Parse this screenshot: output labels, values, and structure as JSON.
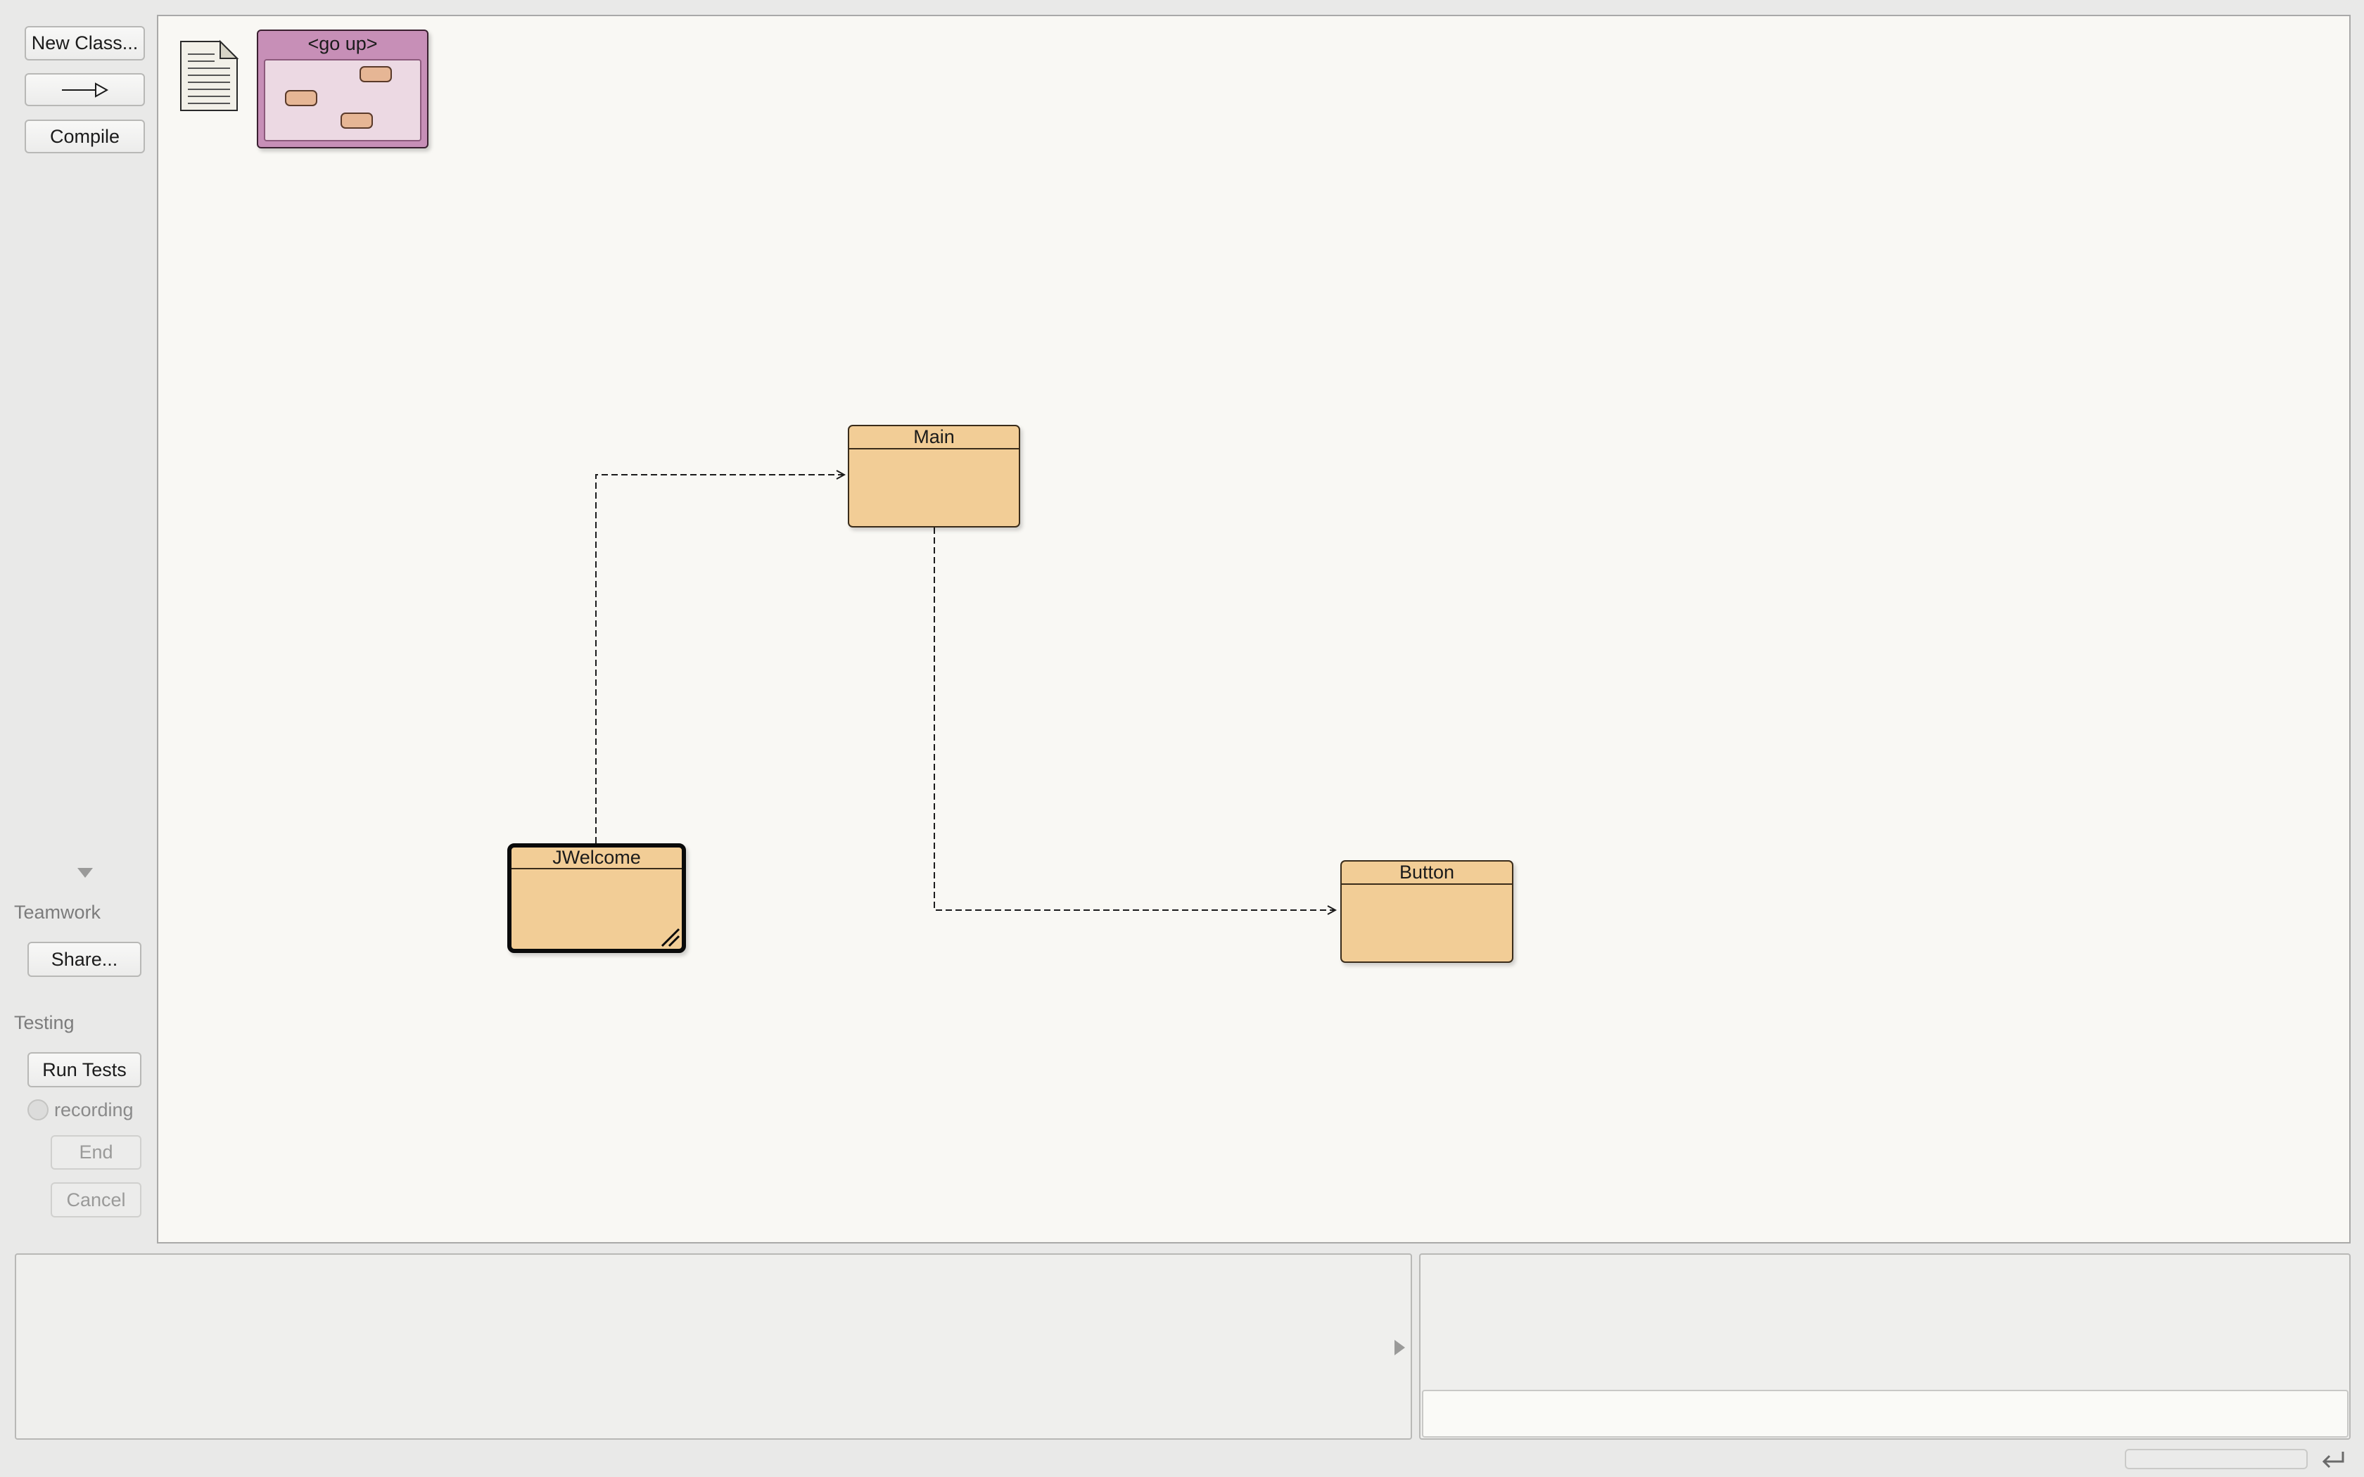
{
  "toolbar": {
    "new_class_label": "New Class...",
    "new_arrow_icon": "inheritance-arrow-icon",
    "compile_label": "Compile"
  },
  "teamwork": {
    "heading": "Teamwork",
    "share_label": "Share..."
  },
  "testing": {
    "heading": "Testing",
    "run_tests_label": "Run Tests",
    "recording_label": "recording",
    "end_label": "End",
    "cancel_label": "Cancel"
  },
  "diagram": {
    "go_up_label": "<go up>",
    "classes": [
      {
        "name": "Main",
        "selected": false
      },
      {
        "name": "JWelcome",
        "selected": true
      },
      {
        "name": "Button",
        "selected": false
      }
    ],
    "dependencies": [
      {
        "from": "JWelcome",
        "to": "Main"
      },
      {
        "from": "Main",
        "to": "Button"
      }
    ]
  },
  "colors": {
    "class_fill": "#f2cd96",
    "package_fill": "#c78fb7",
    "canvas_bg": "#f9f8f4"
  }
}
